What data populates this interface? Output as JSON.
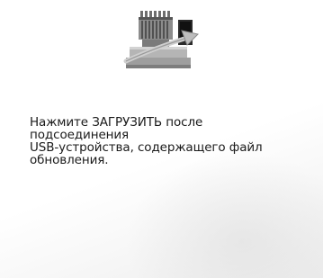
{
  "screen": {
    "illustration_icon": "embroidery-machine-update-icon",
    "message": "Нажмите ЗАГРУЗИТЬ после подсоединения\nUSB-устройства, содержащего файл\nобновления."
  },
  "colors": {
    "background": "#ffffff",
    "text": "#1a1a1a",
    "machine_body": "#9a9a9a",
    "screen_panel": "#1e1e1e",
    "arrow": "#bdbdbd"
  }
}
